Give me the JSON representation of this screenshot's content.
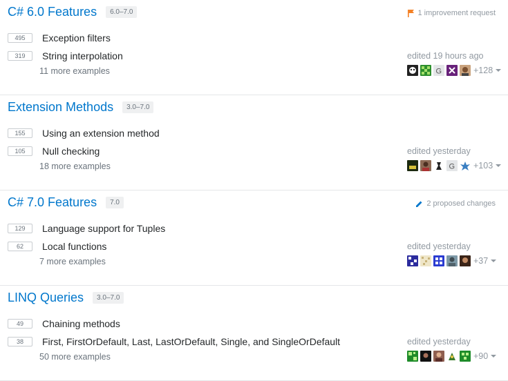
{
  "colors": {
    "link": "#0077cc",
    "flag": "#f48024",
    "pencil": "#0077cc",
    "muted": "#9199a1"
  },
  "topics": [
    {
      "title": "C# 6.0 Features",
      "version": "6.0–7.0",
      "request": {
        "icon": "flag-icon",
        "text": "1 improvement request"
      },
      "examples": [
        {
          "votes": "495",
          "title": "Exception filters"
        },
        {
          "votes": "319",
          "title": "String interpolation"
        }
      ],
      "more": "11 more examples",
      "edited": "edited 19 hours ago",
      "more_editors": "+128"
    },
    {
      "title": "Extension Methods",
      "version": "3.0–7.0",
      "request": null,
      "examples": [
        {
          "votes": "155",
          "title": "Using an extension method"
        },
        {
          "votes": "105",
          "title": "Null checking"
        }
      ],
      "more": "18 more examples",
      "edited": "edited yesterday",
      "more_editors": "+103"
    },
    {
      "title": "C# 7.0 Features",
      "version": "7.0",
      "request": {
        "icon": "pencil-icon",
        "text": "2 proposed changes"
      },
      "examples": [
        {
          "votes": "129",
          "title": "Language support for Tuples"
        },
        {
          "votes": "62",
          "title": "Local functions"
        }
      ],
      "more": "7 more examples",
      "edited": "edited yesterday",
      "more_editors": "+37"
    },
    {
      "title": "LINQ Queries",
      "version": "3.0–7.0",
      "request": null,
      "examples": [
        {
          "votes": "49",
          "title": "Chaining methods"
        },
        {
          "votes": "38",
          "title": "First, FirstOrDefault, Last, LastOrDefault, Single, and SingleOrDefault"
        }
      ],
      "more": "50 more examples",
      "edited": "edited yesterday",
      "more_editors": "+90"
    }
  ]
}
